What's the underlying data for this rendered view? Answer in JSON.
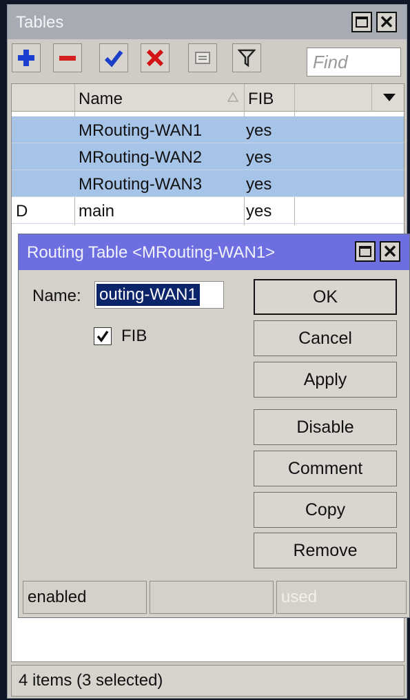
{
  "tables_window": {
    "title": "Tables",
    "toolbar": {
      "add_icon": "plus-icon",
      "remove_icon": "minus-icon",
      "enable_icon": "check-icon",
      "disable_icon": "x-icon",
      "comment_icon": "note-icon",
      "filter_icon": "filter-icon",
      "find_placeholder": "Find"
    },
    "columns": [
      "",
      "Name",
      "FIB"
    ],
    "rows": [
      {
        "flag": "",
        "name": "MRouting-WAN1",
        "fib": "yes",
        "selected": true
      },
      {
        "flag": "",
        "name": "MRouting-WAN2",
        "fib": "yes",
        "selected": true
      },
      {
        "flag": "",
        "name": "MRouting-WAN3",
        "fib": "yes",
        "selected": true
      },
      {
        "flag": "D",
        "name": "main",
        "fib": "yes",
        "selected": false
      }
    ],
    "status": "4 items (3 selected)"
  },
  "dialog": {
    "title": "Routing Table <MRouting-WAN1>",
    "name_label": "Name:",
    "name_value": "outing-WAN1",
    "fib_label": "FIB",
    "fib_checked": true,
    "buttons": {
      "ok": "OK",
      "cancel": "Cancel",
      "apply": "Apply",
      "disable": "Disable",
      "comment": "Comment",
      "copy": "Copy",
      "remove": "Remove"
    },
    "status": {
      "state": "enabled",
      "middle": "",
      "used": "used"
    }
  },
  "colors": {
    "selection": "#a6c3e8",
    "dialog_title": "#6d6fe0"
  }
}
